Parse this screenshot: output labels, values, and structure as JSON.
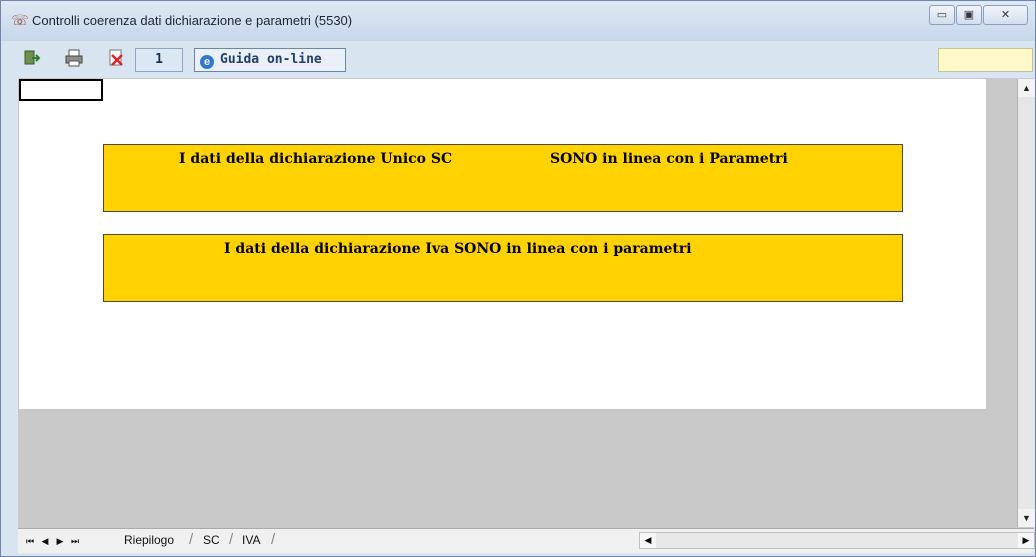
{
  "window": {
    "title": "Controlli coerenza dati dichiarazione e parametri (5530)",
    "controls": {
      "minimize": "▭",
      "maximize": "▣",
      "close": "✕"
    }
  },
  "toolbar": {
    "page_value": "1",
    "help_label": "Guida on-line",
    "icons": [
      "exit-icon",
      "print-icon",
      "delete-icon",
      "ie-icon"
    ]
  },
  "banners": {
    "unico_left": "I dati della dichiarazione Unico SC",
    "unico_right": "SONO in linea con i Parametri",
    "iva": "I dati della dichiarazione Iva SONO in linea con i parametri"
  },
  "sheet_tabs": {
    "tabs": [
      "Riepilogo",
      "SC",
      "IVA"
    ],
    "nav": [
      "⏮",
      "◀",
      "▶",
      "⏭"
    ],
    "active": "Riepilogo"
  },
  "colors": {
    "banner": "#ffd200",
    "window_frame": "#d9e4f1",
    "sheet_background": "#c9c9c9"
  }
}
